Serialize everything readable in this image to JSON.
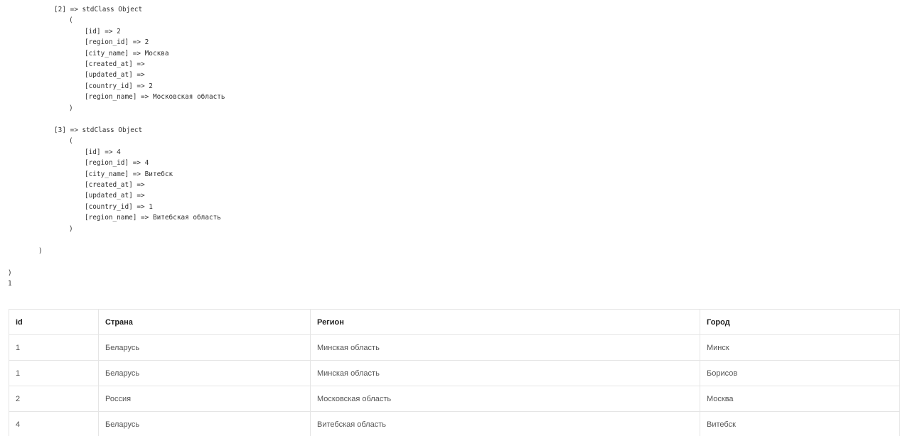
{
  "dump": {
    "lines": [
      "[2] => stdClass Object",
      "(",
      "[id] => 2",
      "[region_id] => 2",
      "[city_name] => Москва",
      "[created_at] =>",
      "[updated_at] =>",
      "[country_id] => 2",
      "[region_name] => Московская область",
      ")",
      "[3] => stdClass Object",
      "(",
      "[id] => 4",
      "[region_id] => 4",
      "[city_name] => Витебск",
      "[created_at] =>",
      "[updated_at] =>",
      "[country_id] => 1",
      "[region_name] => Витебская область",
      ")",
      ")",
      ")",
      "1"
    ]
  },
  "table": {
    "headers": [
      "id",
      "Страна",
      "Регион",
      "Город"
    ],
    "rows": [
      [
        "1",
        "Беларусь",
        "Минская область",
        "Минск"
      ],
      [
        "1",
        "Беларусь",
        "Минская область",
        "Борисов"
      ],
      [
        "2",
        "Россия",
        "Московская область",
        "Москва"
      ],
      [
        "4",
        "Беларусь",
        "Витебская область",
        "Витебск"
      ]
    ]
  }
}
